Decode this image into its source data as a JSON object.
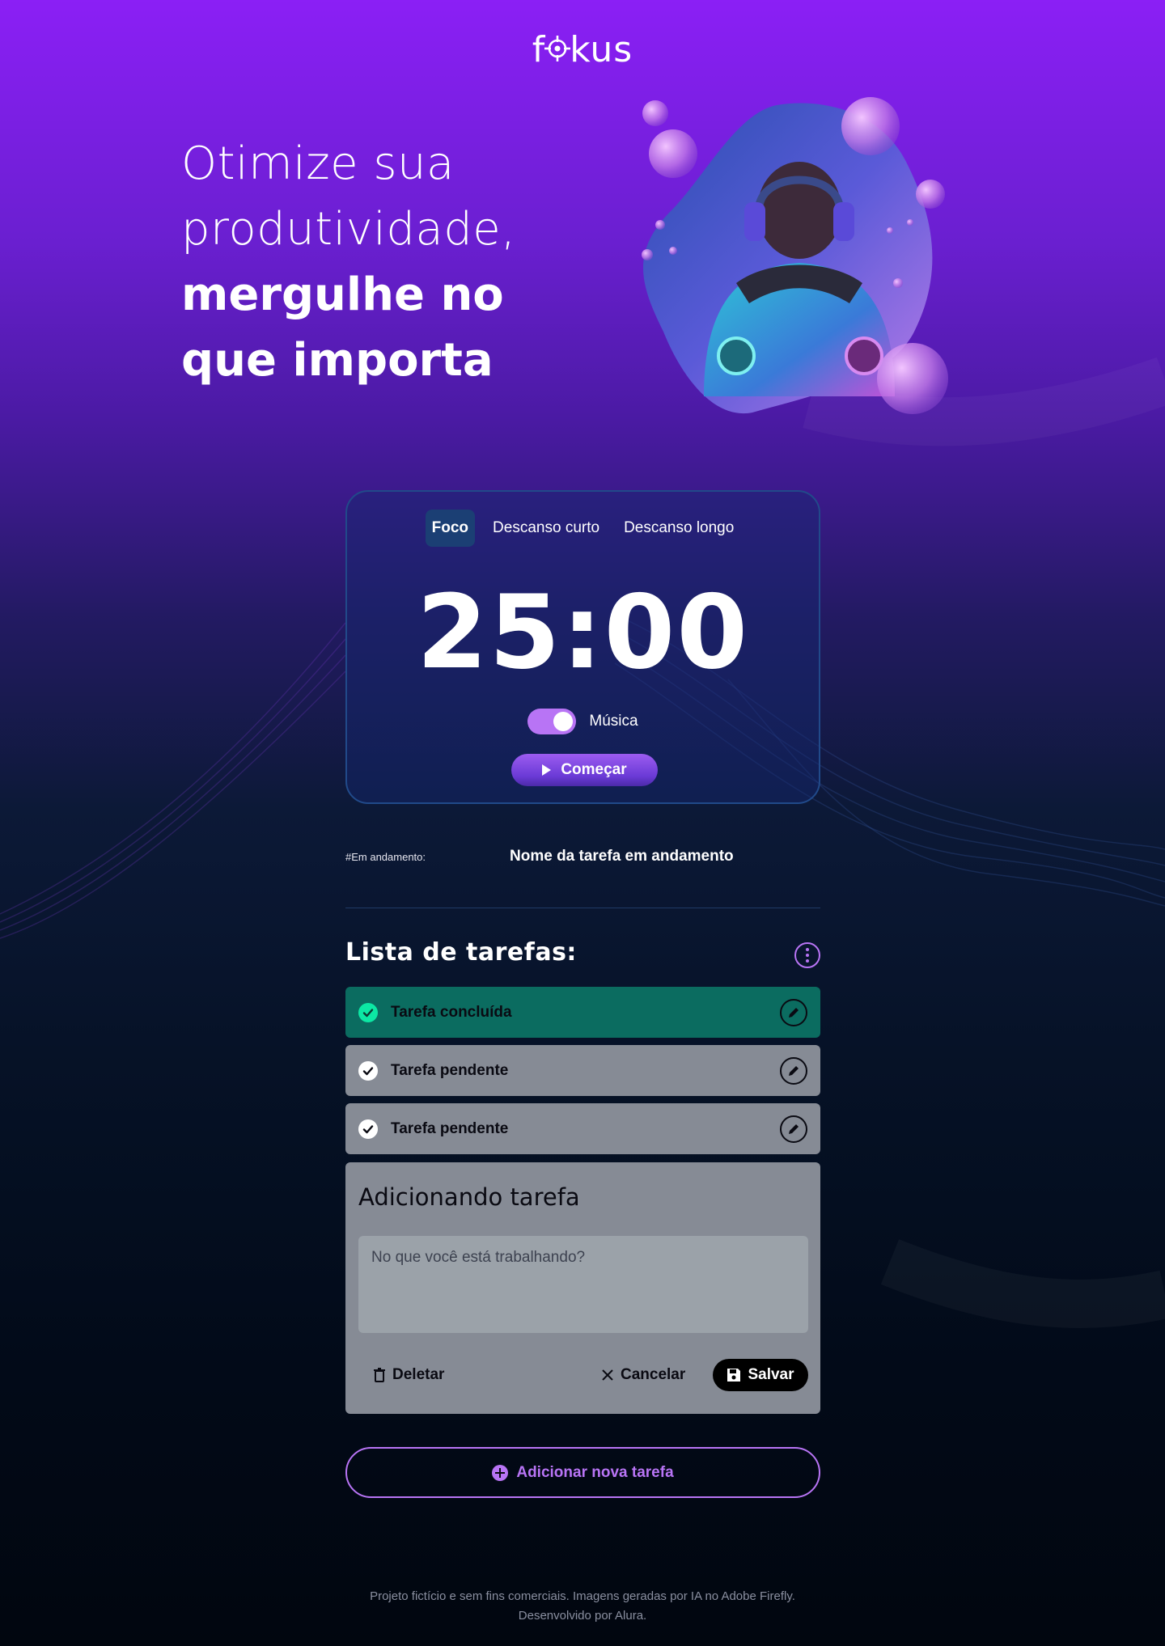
{
  "header": {
    "logo_text_left": "f",
    "logo_text_right": "kus"
  },
  "hero": {
    "line1": "Otimize sua",
    "line2": "produtividade,",
    "line3": "mergulhe no",
    "line4": "que importa"
  },
  "timer": {
    "tabs": [
      "Foco",
      "Descanso curto",
      "Descanso longo"
    ],
    "active_tab": "Foco",
    "time": "25:00",
    "music_label": "Música",
    "music_on": true,
    "start_label": "Começar"
  },
  "in_progress": {
    "label": "#Em andamento:",
    "task_name": "Nome da tarefa em andamento"
  },
  "task_list": {
    "title": "Lista de tarefas:",
    "tasks": [
      {
        "label": "Tarefa concluída",
        "status": "done"
      },
      {
        "label": "Tarefa pendente",
        "status": "pending"
      },
      {
        "label": "Tarefa pendente",
        "status": "pending"
      }
    ]
  },
  "add_form": {
    "title": "Adicionando tarefa",
    "placeholder": "No que você está trabalhando?",
    "delete_label": "Deletar",
    "cancel_label": "Cancelar",
    "save_label": "Salvar"
  },
  "new_task_button": "Adicionar nova tarefa",
  "footer": {
    "line1": "Projeto fictício e sem fins comerciais. Imagens geradas por IA no Adobe Firefly.",
    "line2": "Desenvolvido por Alura."
  },
  "colors": {
    "accent": "#b874f5",
    "done_bg": "#0b6c60",
    "done_check": "#0ce8a4",
    "pending_bg": "#868b95"
  }
}
